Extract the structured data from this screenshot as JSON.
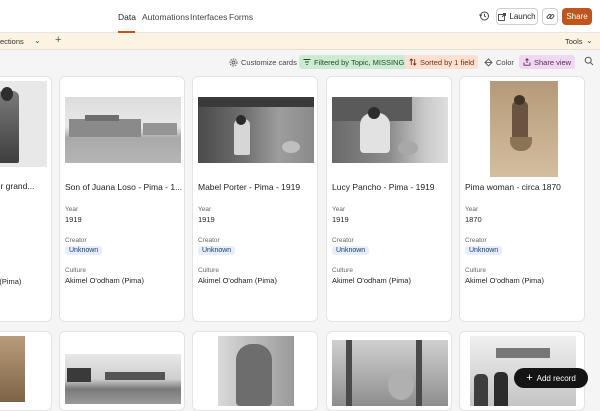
{
  "nav": {
    "tabs": [
      "Data",
      "Automations",
      "Interfaces",
      "Forms"
    ],
    "launch_label": "Launch",
    "share_label": "Share"
  },
  "viewbar": {
    "view_name": "ections",
    "tools_label": "Tools"
  },
  "toolbar": {
    "customize": "Customize cards",
    "filter": "Filtered by Topic, MISSING",
    "sort": "Sorted by 1 field",
    "color": "Color",
    "share_view": "Share view"
  },
  "field_labels": {
    "year": "Year",
    "creator": "Creator",
    "culture": "Culture"
  },
  "cards": [
    {
      "title": "her grand...",
      "year": "",
      "creator": "",
      "culture": "m (Pima)"
    },
    {
      "title": "Son of Juana Loso - Pima - 1...",
      "year": "1919",
      "creator": "Unknown",
      "culture": "Akimel O'odham (Pima)"
    },
    {
      "title": "Mabel Porter - Pima - 1919",
      "year": "1919",
      "creator": "Unknown",
      "culture": "Akimel O'odham (Pima)"
    },
    {
      "title": "Lucy Pancho - Pima - 1919",
      "year": "1919",
      "creator": "Unknown",
      "culture": "Akimel O'odham (Pima)"
    },
    {
      "title": "Pima woman - circa 1870",
      "year": "1870",
      "creator": "Unknown",
      "culture": "Akimel O'odham (Pima)"
    }
  ],
  "add_record_label": "Add record",
  "colors": {
    "accent": "#c0551f",
    "filter_bg": "#cdebd2",
    "sort_bg": "#fde0cf",
    "share_bg": "#f1d8f1",
    "chip_bg": "#e6eefc"
  }
}
